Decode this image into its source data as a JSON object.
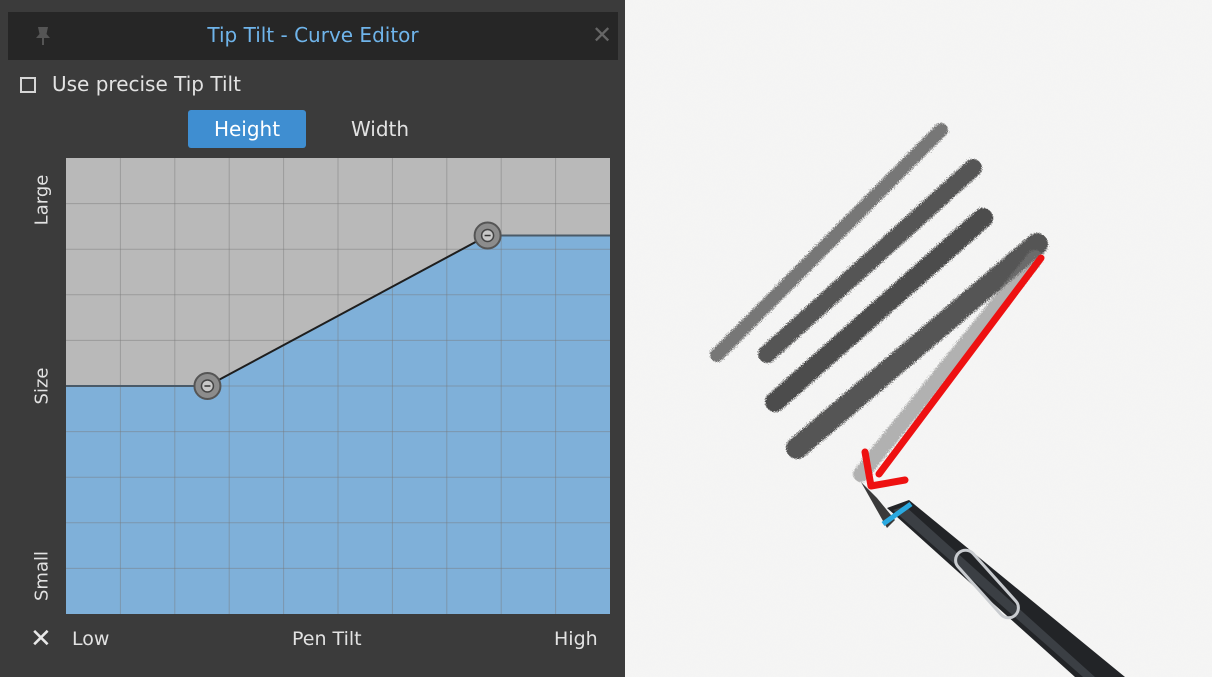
{
  "panel": {
    "title": "Tip Tilt - Curve Editor",
    "title_color": "#6fb4ea",
    "icons": {
      "pin": "pin-icon",
      "close": "close-icon",
      "reset": "x-reset-icon"
    },
    "checkbox": {
      "label": "Use precise Tip Tilt",
      "checked": false
    },
    "tabs": [
      {
        "label": "Height",
        "active": true
      },
      {
        "label": "Width",
        "active": false
      }
    ],
    "accent_color": "#3f8ed1"
  },
  "curve_editor": {
    "y_labels": {
      "top": "Large",
      "middle": "Size",
      "bottom": "Small"
    },
    "x_labels": {
      "left": "Low",
      "center": "Pen Tilt",
      "right": "High"
    },
    "control_points": [
      {
        "tilt": 0.26,
        "size": 0.5
      },
      {
        "tilt": 0.775,
        "size": 0.83
      }
    ],
    "fill_color": "#7fb0d9",
    "background_color": "#b9b9b9",
    "grid_columns": 10,
    "grid_rows": 10
  },
  "illustration": {
    "icons": [
      "pencil-strokes",
      "stylus-pen-icon",
      "red-arrow-icon"
    ],
    "arrow_color": "#ee1111"
  }
}
